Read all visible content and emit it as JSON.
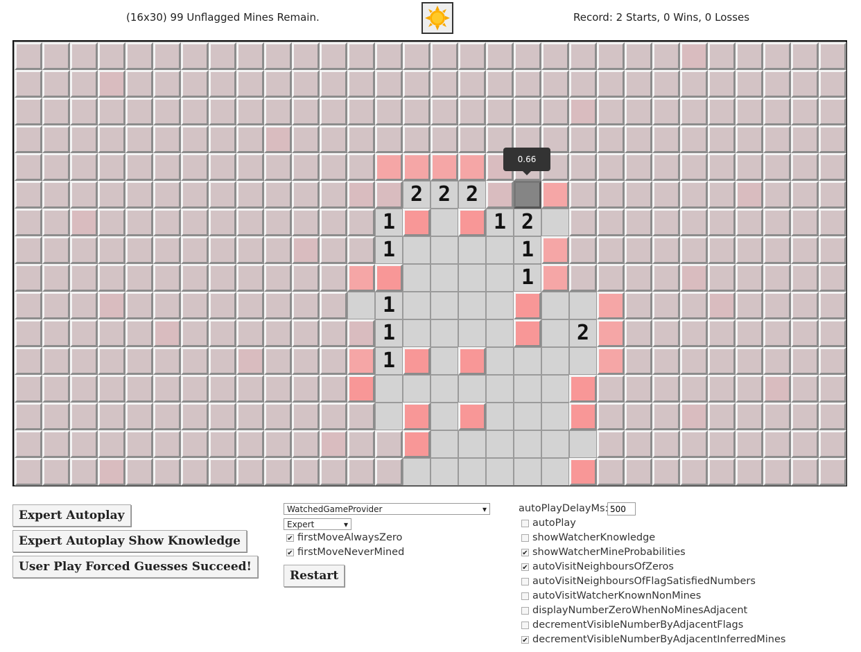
{
  "status": {
    "mines_remaining": "(16x30) 99 Unflagged Mines Remain.",
    "record": "Record: 2 Starts, 0 Wins, 0 Losses"
  },
  "face_icon": "sun-icon",
  "board": {
    "rows": 16,
    "cols": 30,
    "colors": {
      "hidden": "#d3c3c5",
      "hidden_unsafe": "#d9bcbf",
      "hidden_risky": "#f5a6a6",
      "hidden_likely_mine": "#f89797",
      "opened": "#d3d3d3",
      "selected": "#858585"
    },
    "cells": [
      {
        "r": 4,
        "c": 13,
        "t": "h",
        "p": 3
      },
      {
        "r": 4,
        "c": 14,
        "t": "h",
        "p": 3
      },
      {
        "r": 4,
        "c": 15,
        "t": "h",
        "p": 3
      },
      {
        "r": 4,
        "c": 16,
        "t": "h",
        "p": 3
      },
      {
        "r": 4,
        "c": 17,
        "t": "h",
        "p": 2
      },
      {
        "r": 4,
        "c": 19,
        "t": "h",
        "p": 1
      },
      {
        "r": 5,
        "c": 12,
        "t": "h",
        "p": 2
      },
      {
        "r": 5,
        "c": 13,
        "t": "h",
        "p": 2
      },
      {
        "r": 5,
        "c": 14,
        "t": "n",
        "v": 2
      },
      {
        "r": 5,
        "c": 15,
        "t": "n",
        "v": 2
      },
      {
        "r": 5,
        "c": 16,
        "t": "n",
        "v": 2
      },
      {
        "r": 5,
        "c": 17,
        "t": "h",
        "p": 2
      },
      {
        "r": 5,
        "c": 18,
        "t": "s"
      },
      {
        "r": 5,
        "c": 19,
        "t": "h",
        "p": 3
      },
      {
        "r": 6,
        "c": 13,
        "t": "n",
        "v": 1
      },
      {
        "r": 6,
        "c": 14,
        "t": "h",
        "p": 4
      },
      {
        "r": 6,
        "c": 15,
        "t": "o"
      },
      {
        "r": 6,
        "c": 16,
        "t": "h",
        "p": 4
      },
      {
        "r": 6,
        "c": 17,
        "t": "n",
        "v": 1
      },
      {
        "r": 6,
        "c": 18,
        "t": "n",
        "v": 2
      },
      {
        "r": 6,
        "c": 19,
        "t": "o"
      },
      {
        "r": 7,
        "c": 13,
        "t": "n",
        "v": 1
      },
      {
        "r": 7,
        "c": 14,
        "t": "o"
      },
      {
        "r": 7,
        "c": 15,
        "t": "o"
      },
      {
        "r": 7,
        "c": 16,
        "t": "o"
      },
      {
        "r": 7,
        "c": 17,
        "t": "o"
      },
      {
        "r": 7,
        "c": 18,
        "t": "n",
        "v": 1
      },
      {
        "r": 7,
        "c": 19,
        "t": "h",
        "p": 3
      },
      {
        "r": 8,
        "c": 12,
        "t": "h",
        "p": 3
      },
      {
        "r": 8,
        "c": 13,
        "t": "h",
        "p": 4
      },
      {
        "r": 8,
        "c": 14,
        "t": "o"
      },
      {
        "r": 8,
        "c": 15,
        "t": "o"
      },
      {
        "r": 8,
        "c": 16,
        "t": "o"
      },
      {
        "r": 8,
        "c": 17,
        "t": "o"
      },
      {
        "r": 8,
        "c": 18,
        "t": "n",
        "v": 1
      },
      {
        "r": 8,
        "c": 19,
        "t": "h",
        "p": 3
      },
      {
        "r": 9,
        "c": 12,
        "t": "o"
      },
      {
        "r": 9,
        "c": 13,
        "t": "n",
        "v": 1
      },
      {
        "r": 9,
        "c": 14,
        "t": "o"
      },
      {
        "r": 9,
        "c": 15,
        "t": "o"
      },
      {
        "r": 9,
        "c": 16,
        "t": "o"
      },
      {
        "r": 9,
        "c": 17,
        "t": "o"
      },
      {
        "r": 9,
        "c": 18,
        "t": "h",
        "p": 4
      },
      {
        "r": 9,
        "c": 19,
        "t": "o"
      },
      {
        "r": 9,
        "c": 20,
        "t": "o"
      },
      {
        "r": 9,
        "c": 21,
        "t": "h",
        "p": 3
      },
      {
        "r": 10,
        "c": 12,
        "t": "h",
        "p": 2
      },
      {
        "r": 10,
        "c": 13,
        "t": "n",
        "v": 1
      },
      {
        "r": 10,
        "c": 14,
        "t": "o"
      },
      {
        "r": 10,
        "c": 15,
        "t": "o"
      },
      {
        "r": 10,
        "c": 16,
        "t": "o"
      },
      {
        "r": 10,
        "c": 17,
        "t": "o"
      },
      {
        "r": 10,
        "c": 18,
        "t": "h",
        "p": 4
      },
      {
        "r": 10,
        "c": 19,
        "t": "o"
      },
      {
        "r": 10,
        "c": 20,
        "t": "n",
        "v": 2
      },
      {
        "r": 10,
        "c": 21,
        "t": "h",
        "p": 3
      },
      {
        "r": 11,
        "c": 12,
        "t": "h",
        "p": 3
      },
      {
        "r": 11,
        "c": 13,
        "t": "n",
        "v": 1
      },
      {
        "r": 11,
        "c": 14,
        "t": "h",
        "p": 4
      },
      {
        "r": 11,
        "c": 15,
        "t": "o"
      },
      {
        "r": 11,
        "c": 16,
        "t": "h",
        "p": 4
      },
      {
        "r": 11,
        "c": 17,
        "t": "o"
      },
      {
        "r": 11,
        "c": 18,
        "t": "o"
      },
      {
        "r": 11,
        "c": 19,
        "t": "o"
      },
      {
        "r": 11,
        "c": 20,
        "t": "o"
      },
      {
        "r": 11,
        "c": 21,
        "t": "h",
        "p": 3
      },
      {
        "r": 12,
        "c": 12,
        "t": "h",
        "p": 4
      },
      {
        "r": 12,
        "c": 13,
        "t": "o"
      },
      {
        "r": 12,
        "c": 14,
        "t": "o"
      },
      {
        "r": 12,
        "c": 15,
        "t": "o"
      },
      {
        "r": 12,
        "c": 16,
        "t": "o"
      },
      {
        "r": 12,
        "c": 17,
        "t": "o"
      },
      {
        "r": 12,
        "c": 18,
        "t": "o"
      },
      {
        "r": 12,
        "c": 19,
        "t": "o"
      },
      {
        "r": 12,
        "c": 20,
        "t": "h",
        "p": 4
      },
      {
        "r": 13,
        "c": 13,
        "t": "o"
      },
      {
        "r": 13,
        "c": 14,
        "t": "h",
        "p": 4
      },
      {
        "r": 13,
        "c": 15,
        "t": "o"
      },
      {
        "r": 13,
        "c": 16,
        "t": "h",
        "p": 4
      },
      {
        "r": 13,
        "c": 17,
        "t": "o"
      },
      {
        "r": 13,
        "c": 18,
        "t": "o"
      },
      {
        "r": 13,
        "c": 19,
        "t": "o"
      },
      {
        "r": 13,
        "c": 20,
        "t": "h",
        "p": 4
      },
      {
        "r": 14,
        "c": 14,
        "t": "h",
        "p": 4
      },
      {
        "r": 14,
        "c": 15,
        "t": "o"
      },
      {
        "r": 14,
        "c": 16,
        "t": "o"
      },
      {
        "r": 14,
        "c": 17,
        "t": "o"
      },
      {
        "r": 14,
        "c": 18,
        "t": "o"
      },
      {
        "r": 14,
        "c": 19,
        "t": "o"
      },
      {
        "r": 14,
        "c": 20,
        "t": "o"
      },
      {
        "r": 15,
        "c": 14,
        "t": "o"
      },
      {
        "r": 15,
        "c": 15,
        "t": "o"
      },
      {
        "r": 15,
        "c": 16,
        "t": "o"
      },
      {
        "r": 15,
        "c": 17,
        "t": "o"
      },
      {
        "r": 15,
        "c": 18,
        "t": "o"
      },
      {
        "r": 15,
        "c": 19,
        "t": "o"
      },
      {
        "r": 15,
        "c": 20,
        "t": "h",
        "p": 4
      }
    ],
    "tinted_cells": [
      {
        "r": 0,
        "c": 24
      },
      {
        "r": 1,
        "c": 3
      },
      {
        "r": 2,
        "c": 20
      },
      {
        "r": 3,
        "c": 9
      },
      {
        "r": 5,
        "c": 26
      },
      {
        "r": 6,
        "c": 2
      },
      {
        "r": 7,
        "c": 10
      },
      {
        "r": 8,
        "c": 24
      },
      {
        "r": 9,
        "c": 3
      },
      {
        "r": 9,
        "c": 25
      },
      {
        "r": 10,
        "c": 5
      },
      {
        "r": 11,
        "c": 8
      },
      {
        "r": 12,
        "c": 27
      },
      {
        "r": 13,
        "c": 24
      },
      {
        "r": 14,
        "c": 11
      },
      {
        "r": 15,
        "c": 3
      }
    ]
  },
  "tooltip": "0.66",
  "buttons": {
    "expert_autoplay": "Expert Autoplay",
    "expert_autoplay_knowledge": "Expert Autoplay Show Knowledge",
    "user_play": "User Play Forced Guesses Succeed!",
    "restart": "Restart"
  },
  "provider_select": {
    "value": "WatchedGameProvider"
  },
  "difficulty_select": {
    "value": "Expert"
  },
  "options_left": [
    {
      "label": "firstMoveAlwaysZero",
      "checked": true
    },
    {
      "label": "firstMoveNeverMined",
      "checked": true
    }
  ],
  "delay": {
    "label": "autoPlayDelayMs:",
    "value": "500"
  },
  "options_right": [
    {
      "label": "autoPlay",
      "checked": false
    },
    {
      "label": "showWatcherKnowledge",
      "checked": false
    },
    {
      "label": "showWatcherMineProbabilities",
      "checked": true
    },
    {
      "label": "autoVisitNeighboursOfZeros",
      "checked": true
    },
    {
      "label": "autoVisitNeighboursOfFlagSatisfiedNumbers",
      "checked": false
    },
    {
      "label": "autoVisitWatcherKnownNonMines",
      "checked": false
    },
    {
      "label": "displayNumberZeroWhenNoMinesAdjacent",
      "checked": false
    },
    {
      "label": "decrementVisibleNumberByAdjacentFlags",
      "checked": false
    },
    {
      "label": "decrementVisibleNumberByAdjacentInferredMines",
      "checked": true
    }
  ]
}
